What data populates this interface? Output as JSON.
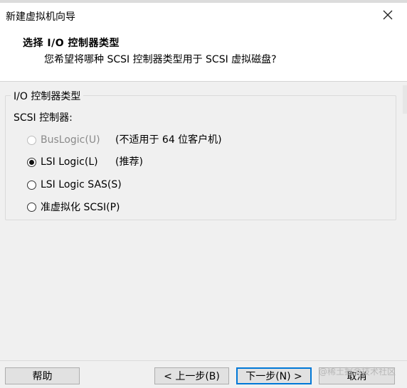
{
  "window": {
    "title": "新建虚拟机向导"
  },
  "header": {
    "title": "选择 I/O 控制器类型",
    "subtitle": "您希望将哪种 SCSI 控制器类型用于 SCSI 虚拟磁盘?"
  },
  "group": {
    "legend": "I/O 控制器类型",
    "label": "SCSI 控制器:",
    "options": [
      {
        "label": "BusLogic(U)",
        "note": "(不适用于 64 位客户机)",
        "selected": false,
        "disabled": true
      },
      {
        "label": "LSI Logic(L)",
        "note": "(推荐)",
        "selected": true,
        "disabled": false
      },
      {
        "label": "LSI Logic SAS(S)",
        "note": "",
        "selected": false,
        "disabled": false
      },
      {
        "label": "准虚拟化 SCSI(P)",
        "note": "",
        "selected": false,
        "disabled": false
      }
    ]
  },
  "buttons": {
    "help": "帮助",
    "back": "< 上一步(B)",
    "next": "下一步(N) >",
    "cancel": "取消"
  },
  "watermark": "@稀土掘金技术社区"
}
